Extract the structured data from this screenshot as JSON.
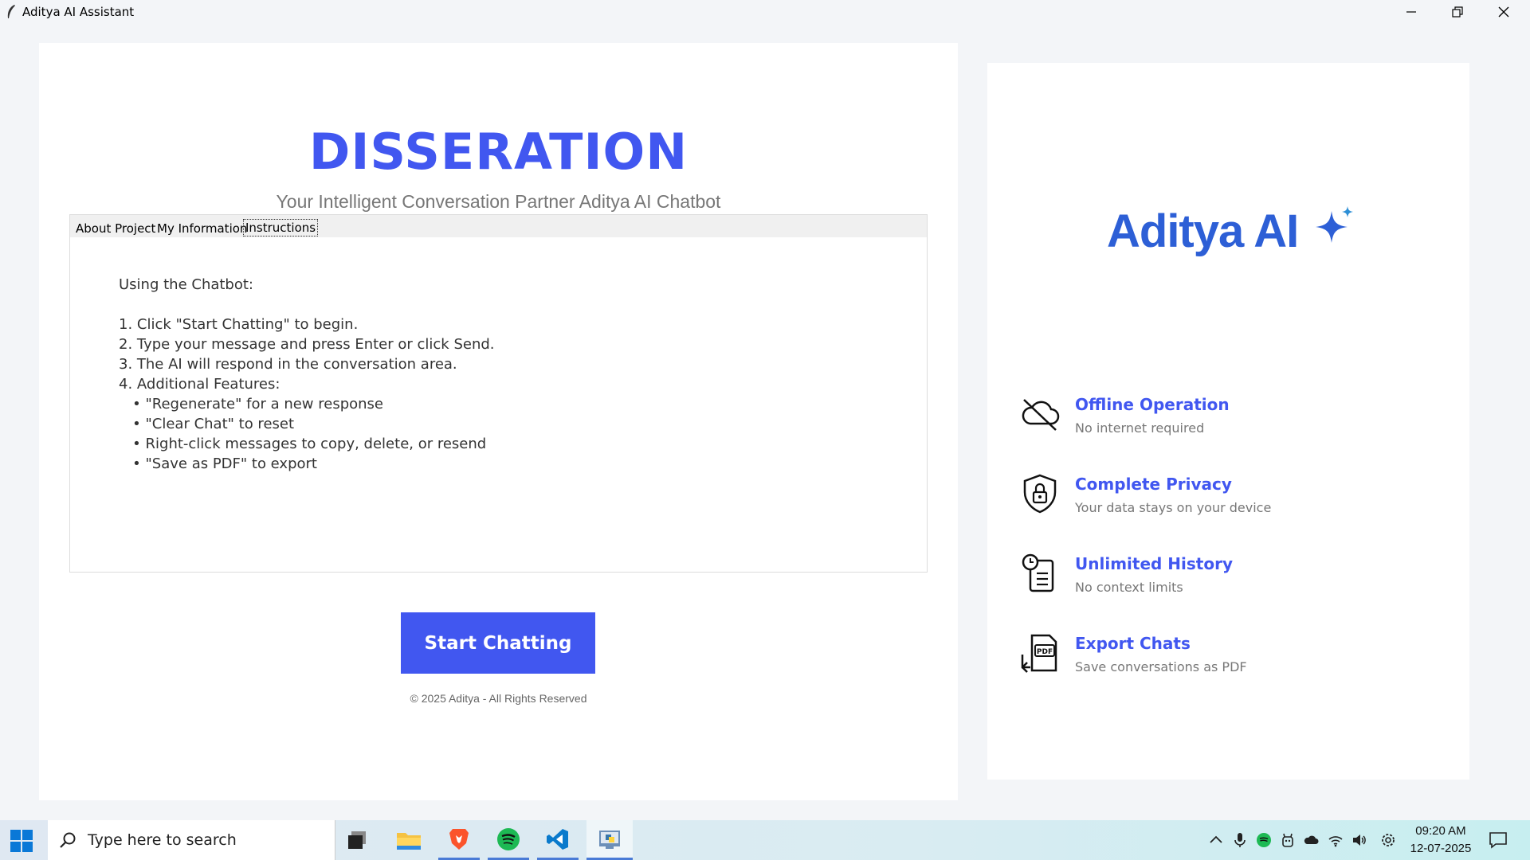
{
  "window": {
    "title": "Aditya AI Assistant"
  },
  "main": {
    "heading": "DISSERATION",
    "subheading": "Your Intelligent Conversation Partner Aditya AI Chatbot",
    "tabs": [
      {
        "label": "About Project",
        "active": false
      },
      {
        "label": "My Information",
        "active": false
      },
      {
        "label": "Instructions",
        "active": true
      }
    ],
    "instructions": {
      "title": "Using the Chatbot:",
      "lines": [
        "1. Click \"Start Chatting\" to begin.",
        "2. Type your message and press Enter or click Send.",
        "3. The AI will respond in the conversation area.",
        "4. Additional Features:",
        "   • \"Regenerate\" for a new response",
        "   • \"Clear Chat\" to reset",
        "   • Right-click messages to copy, delete, or resend",
        "   • \"Save as PDF\" to export"
      ]
    },
    "start_button": "Start Chatting",
    "footer": "© 2025 Aditya - All Rights Reserved"
  },
  "sidebar": {
    "logo_text": "Aditya AI",
    "features": [
      {
        "icon": "cloud-off-icon",
        "title": "Offline Operation",
        "desc": "No internet required"
      },
      {
        "icon": "shield-lock-icon",
        "title": "Complete Privacy",
        "desc": "Your data stays on your device"
      },
      {
        "icon": "history-icon",
        "title": "Unlimited History",
        "desc": "No context limits"
      },
      {
        "icon": "pdf-export-icon",
        "title": "Export Chats",
        "desc": "Save conversations as PDF"
      }
    ]
  },
  "taskbar": {
    "search_placeholder": "Type here to search",
    "apps": [
      "task-view-icon",
      "file-explorer-icon",
      "brave-icon",
      "spotify-icon",
      "vscode-icon",
      "python-app-icon"
    ],
    "tray": [
      "chevron-up-icon",
      "microphone-icon",
      "spotify-tray-icon",
      "app-tray-icon",
      "cloud-tray-icon",
      "wifi-icon",
      "volume-icon",
      "settings-icon"
    ],
    "time": "09:20 AM",
    "date": "12-07-2025"
  },
  "colors": {
    "accent": "#4157f0",
    "logo_blue": "#2d5fd6"
  }
}
